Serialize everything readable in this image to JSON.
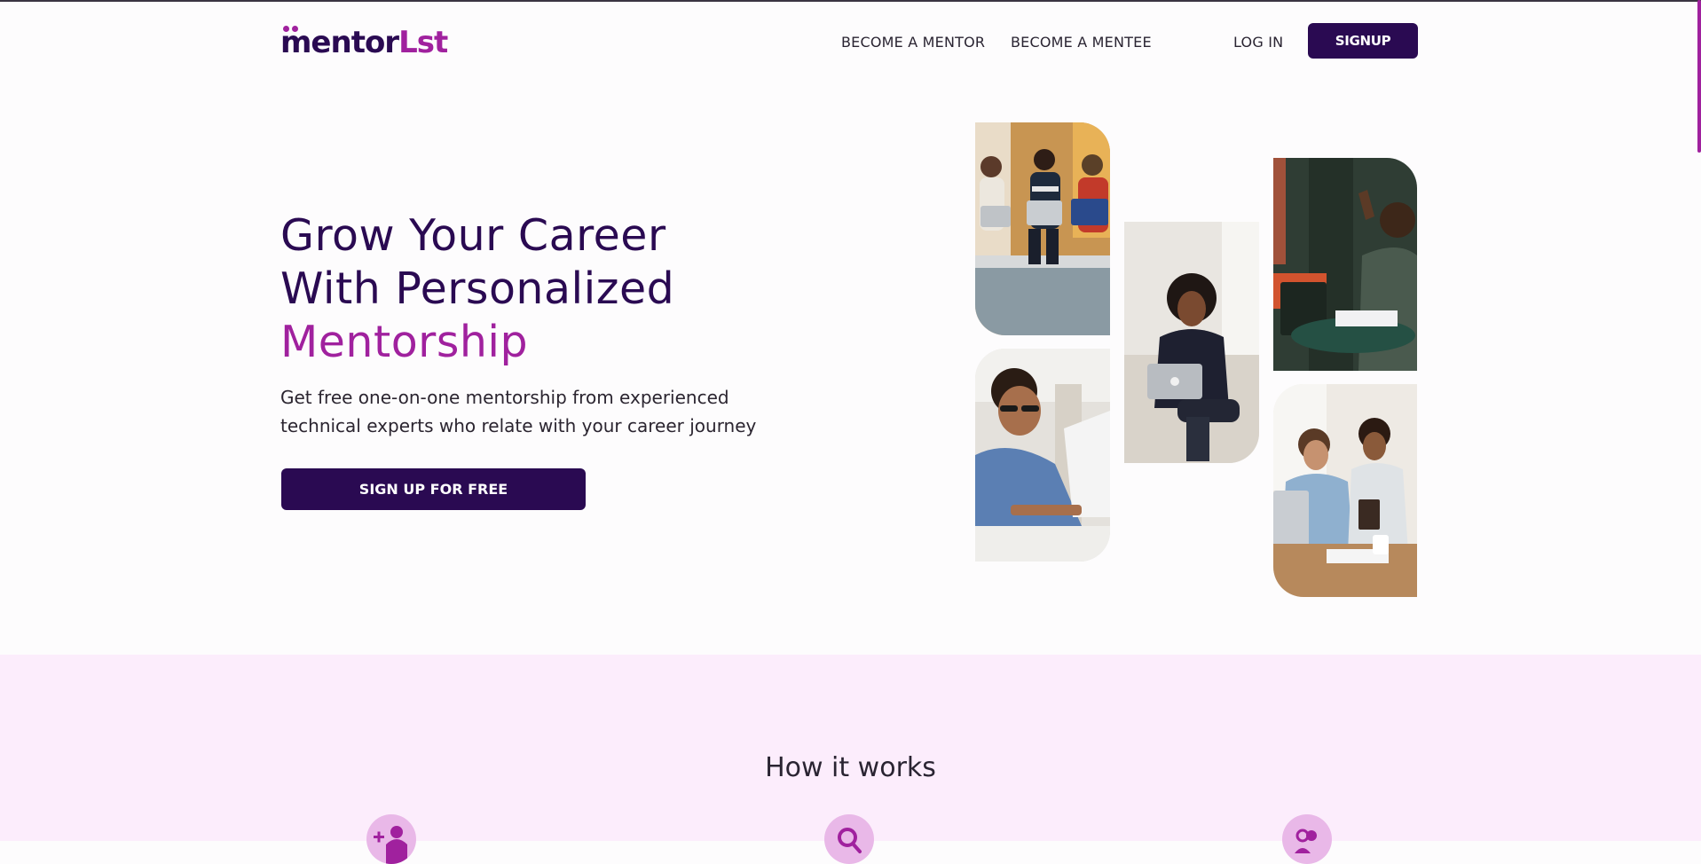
{
  "brand": {
    "logo_text_main": "mentor",
    "logo_text_accent": "Lst",
    "logo_alt": "mentorLst"
  },
  "nav": {
    "become_mentor": "BECOME A MENTOR",
    "become_mentee": "BECOME A MENTEE",
    "login": "LOG IN",
    "signup": "SIGNUP"
  },
  "hero": {
    "title_line1": "Grow Your Career",
    "title_line2": "With Personalized",
    "title_highlight": "Mentorship",
    "subtitle": "Get free one-on-one mentorship from experienced technical experts who relate with your career journey",
    "cta": "SIGN UP FOR FREE"
  },
  "photos": [
    {
      "name": "photo-group-laptops",
      "subject": "three women with laptops on a couch"
    },
    {
      "name": "photo-man-laptop",
      "subject": "man typing on a laptop"
    },
    {
      "name": "photo-woman-laptop",
      "subject": "woman sitting with a laptop"
    },
    {
      "name": "photo-meeting",
      "subject": "people talking at a table"
    },
    {
      "name": "photo-pair-working",
      "subject": "two people working at a desk"
    }
  ],
  "how_it_works": {
    "title": "How it works",
    "steps": [
      {
        "icon": "add-user-icon"
      },
      {
        "icon": "search-icon"
      },
      {
        "icon": "connect-icon"
      }
    ]
  },
  "colors": {
    "brand_dark": "#2a0a52",
    "brand_accent": "#a0219e",
    "section_bg": "#fcedfc",
    "icon_bg": "#e9b8e8"
  }
}
